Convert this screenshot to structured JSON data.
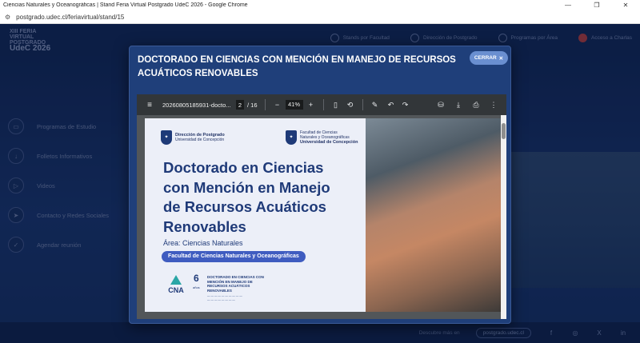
{
  "browser": {
    "window_title": "Ciencias Naturales y Oceanográficas | Stand Feria Virtual Postgrado UdeC 2026 - Google Chrome",
    "url": "postgrado.udec.cl/feriavirtual/stand/15",
    "controls": [
      "—",
      "❐",
      "✕"
    ]
  },
  "site": {
    "logo_lines": [
      "XIII FERIA",
      "VIRTUAL",
      "POSTGRADO",
      "UdeC 2026"
    ],
    "nav": [
      "Stands por Facultad",
      "Dirección de Postgrado",
      "Programas por Área",
      "Acceso a Charlas"
    ],
    "side_menu": [
      "Programas de Estudio",
      "Folletos Informativos",
      "Videos",
      "Contacto y Redes Sociales",
      "Agendar reunión"
    ],
    "footer_text": "Descubre más en",
    "footer_link": "postgrado.udec.cl"
  },
  "modal": {
    "title": "DOCTORADO EN CIENCIAS CON MENCIÓN EN MANEJO DE RECURSOS ACUÁTICOS RENOVABLES",
    "close_label": "CERRAR"
  },
  "pdf_viewer": {
    "filename": "20260805185931-docto...",
    "current_page": "2",
    "total_pages": "/ 16",
    "zoom": "41%"
  },
  "brochure": {
    "org1_name": "Dirección de Postgrado",
    "org1_sub": "Universidad de Concepción",
    "org2_line1": "Facultad de Ciencias",
    "org2_line2": "Naturales y Oceanográficas",
    "org2_sub": "Universidad de Concepción",
    "title": "Doctorado en Ciencias con Mención en Manejo de Recursos Acuáticos Renovables",
    "area": "Área: Ciencias Naturales",
    "faculty": "Facultad de Ciencias Naturales y Oceanográficas",
    "cna_label": "CNA",
    "years_number": "6",
    "years_label": "años",
    "accreditation_title": "DOCTORADO EN CIENCIAS CON MENCIÓN EN MANEJO DE RECURSOS ACUÁTICOS RENOVABLES"
  }
}
